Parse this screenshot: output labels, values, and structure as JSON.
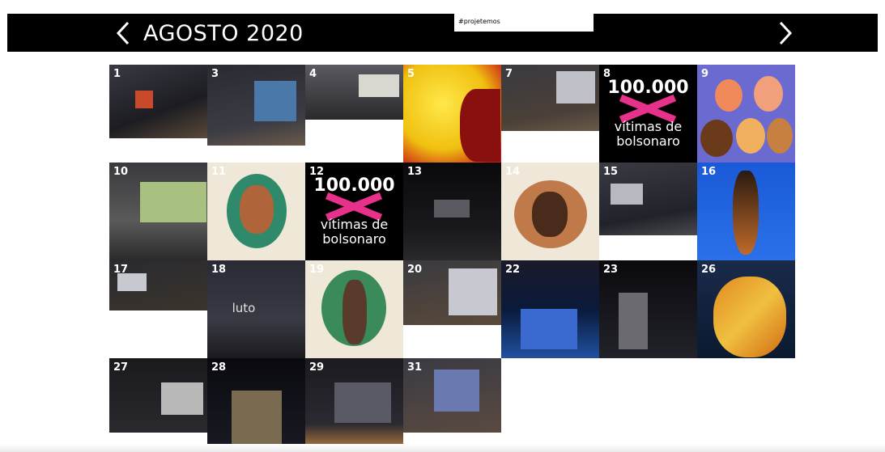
{
  "header": {
    "month_title": "AGOSTO 2020",
    "hashtag": "#projetemos",
    "prev_icon": "chevron-left-icon",
    "next_icon": "chevron-right-icon"
  },
  "days": [
    {
      "day": "1"
    },
    {
      "day": "3"
    },
    {
      "day": "4"
    },
    {
      "day": "5"
    },
    {
      "day": "7"
    },
    {
      "day": "8",
      "line1": "100.000",
      "line2": "vítimas de",
      "line3": "bolsonaro"
    },
    {
      "day": "9"
    },
    {
      "day": "10"
    },
    {
      "day": "11"
    },
    {
      "day": "12",
      "line1": "100.000",
      "line2": "vítimas de",
      "line3": "bolsonaro"
    },
    {
      "day": "13"
    },
    {
      "day": "14"
    },
    {
      "day": "15"
    },
    {
      "day": "16"
    },
    {
      "day": "17"
    },
    {
      "day": "18",
      "line1": "luto"
    },
    {
      "day": "19"
    },
    {
      "day": "20"
    },
    {
      "day": "22"
    },
    {
      "day": "23"
    },
    {
      "day": "26"
    },
    {
      "day": "27"
    },
    {
      "day": "28"
    },
    {
      "day": "29"
    },
    {
      "day": "31"
    }
  ]
}
